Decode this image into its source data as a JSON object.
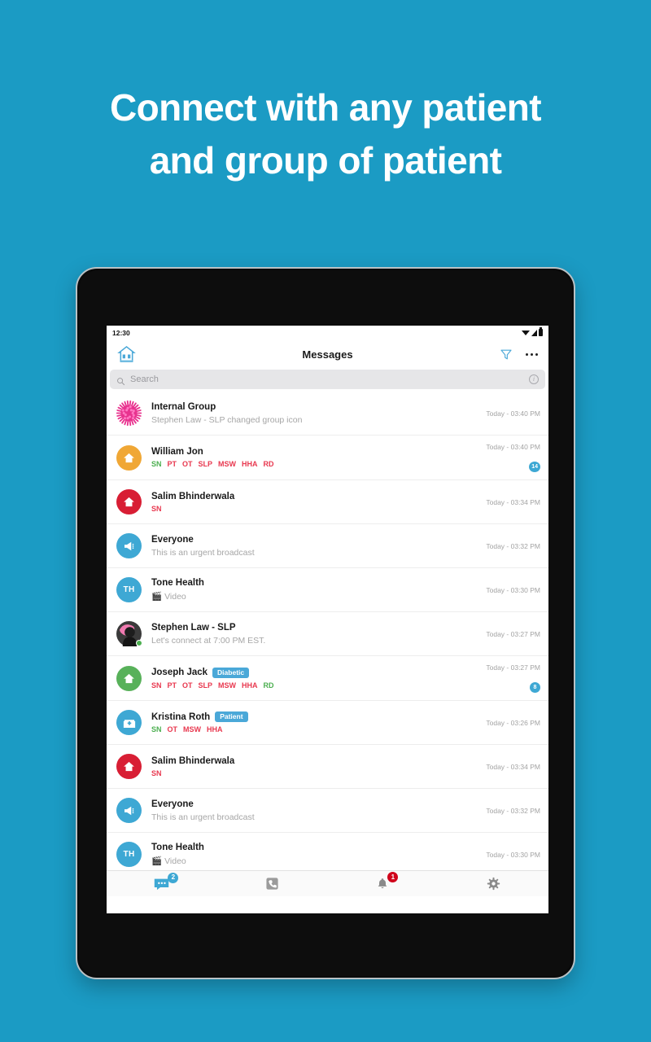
{
  "hero": {
    "line1": "Connect with any patient",
    "line2": "and group of patient"
  },
  "theme": {
    "background": "#1b9bc4",
    "accent": "#3ea8d4",
    "badge_red": "#d0021b",
    "tag_green": "#4caf50",
    "tag_red": "#e8384f"
  },
  "status_bar": {
    "time": "12:30",
    "icons": [
      "wifi-icon",
      "signal-icon",
      "battery-icon"
    ]
  },
  "appbar": {
    "logo": "home-logo-icon",
    "title": "Messages",
    "filter_icon": "filter-icon",
    "more_icon": "more-options-icon"
  },
  "search": {
    "icon": "search-icon",
    "placeholder": "Search",
    "info_icon": "info-icon",
    "info_glyph": "i"
  },
  "conversations": [
    {
      "name": "Internal Group",
      "avatar": "virus-cluster-icon",
      "avatar_color": "#e8338f",
      "preview": "Stephen Law - SLP changed group icon",
      "time": "Today - 03:40 PM",
      "badge": null,
      "pill": null,
      "tags": [],
      "online": false
    },
    {
      "name": "William Jon",
      "avatar": "home-icon",
      "avatar_color": "#f0a735",
      "preview": null,
      "time": "Today - 03:40 PM",
      "badge": "14",
      "pill": null,
      "tags": [
        {
          "label": "SN",
          "color": "#4caf50"
        },
        {
          "label": "PT",
          "color": "#e8384f"
        },
        {
          "label": "OT",
          "color": "#e8384f"
        },
        {
          "label": "SLP",
          "color": "#e8384f"
        },
        {
          "label": "MSW",
          "color": "#e8384f"
        },
        {
          "label": "HHA",
          "color": "#e8384f"
        },
        {
          "label": "RD",
          "color": "#e8384f"
        }
      ],
      "online": false
    },
    {
      "name": "Salim Bhinderwala",
      "avatar": "home-icon",
      "avatar_color": "#d81e34",
      "preview": null,
      "time": "Today - 03:34 PM",
      "badge": null,
      "pill": null,
      "tags": [
        {
          "label": "SN",
          "color": "#e8384f"
        }
      ],
      "online": false
    },
    {
      "name": "Everyone",
      "avatar": "megaphone-icon",
      "avatar_color": "#3ea8d4",
      "preview": "This is an urgent broadcast",
      "time": "Today - 03:32 PM",
      "badge": null,
      "pill": null,
      "tags": [],
      "online": false
    },
    {
      "name": "Tone Health",
      "avatar": "initials",
      "avatar_initials": "TH",
      "avatar_color": "#3ea8d4",
      "preview": "Video",
      "preview_icon": "video-clapper-icon",
      "time": "Today - 03:30 PM",
      "badge": null,
      "pill": null,
      "tags": [],
      "online": false
    },
    {
      "name": "Stephen Law - SLP",
      "avatar": "photo-icon",
      "avatar_color": "#2b2b2b",
      "preview": "Let's connect at 7:00 PM EST.",
      "time": "Today - 03:27 PM",
      "badge": null,
      "pill": null,
      "tags": [],
      "online": true
    },
    {
      "name": "Joseph Jack",
      "avatar": "home-icon",
      "avatar_color": "#58b15a",
      "preview": null,
      "time": "Today - 03:27 PM",
      "badge": "8",
      "pill": "Diabetic",
      "tags": [
        {
          "label": "SN",
          "color": "#e8384f"
        },
        {
          "label": "PT",
          "color": "#e8384f"
        },
        {
          "label": "OT",
          "color": "#e8384f"
        },
        {
          "label": "SLP",
          "color": "#e8384f"
        },
        {
          "label": "MSW",
          "color": "#e8384f"
        },
        {
          "label": "HHA",
          "color": "#e8384f"
        },
        {
          "label": "RD",
          "color": "#4caf50"
        }
      ],
      "online": false
    },
    {
      "name": "Kristina Roth",
      "avatar": "hospital-icon",
      "avatar_color": "#3ea8d4",
      "preview": null,
      "time": "Today - 03:26 PM",
      "badge": null,
      "pill": "Patient",
      "tags": [
        {
          "label": "SN",
          "color": "#4caf50"
        },
        {
          "label": "OT",
          "color": "#e8384f"
        },
        {
          "label": "MSW",
          "color": "#e8384f"
        },
        {
          "label": "HHA",
          "color": "#e8384f"
        }
      ],
      "online": false
    },
    {
      "name": "Salim Bhinderwala",
      "avatar": "home-icon",
      "avatar_color": "#d81e34",
      "preview": null,
      "time": "Today - 03:34 PM",
      "badge": null,
      "pill": null,
      "tags": [
        {
          "label": "SN",
          "color": "#e8384f"
        }
      ],
      "online": false
    },
    {
      "name": "Everyone",
      "avatar": "megaphone-icon",
      "avatar_color": "#3ea8d4",
      "preview": "This is an urgent broadcast",
      "time": "Today - 03:32 PM",
      "badge": null,
      "pill": null,
      "tags": [],
      "online": false
    },
    {
      "name": "Tone Health",
      "avatar": "initials",
      "avatar_initials": "TH",
      "avatar_color": "#3ea8d4",
      "preview": "Video",
      "preview_icon": "video-clapper-icon",
      "time": "Today - 03:30 PM",
      "badge": null,
      "pill": null,
      "tags": [],
      "online": false
    }
  ],
  "tabbar": [
    {
      "name": "messages",
      "icon": "chat-bubble-icon",
      "badge": "2",
      "badge_color": "blue",
      "active": true
    },
    {
      "name": "calls",
      "icon": "phone-icon",
      "badge": null,
      "active": false
    },
    {
      "name": "notifications",
      "icon": "bell-icon",
      "badge": "1",
      "badge_color": "red",
      "active": false
    },
    {
      "name": "settings",
      "icon": "gear-icon",
      "badge": null,
      "active": false
    }
  ]
}
